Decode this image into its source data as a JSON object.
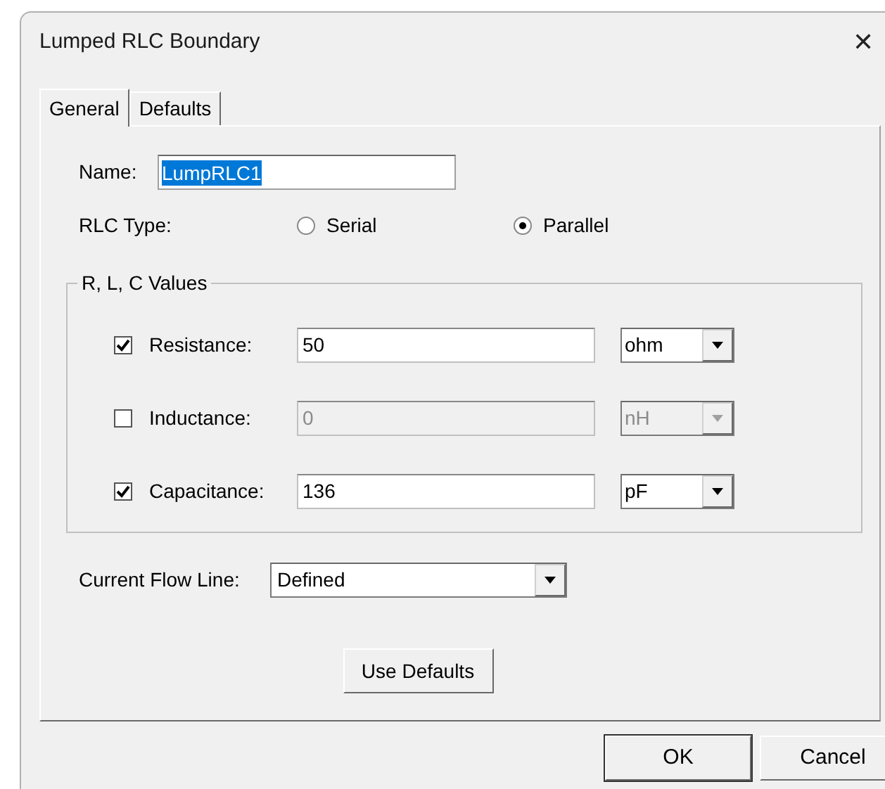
{
  "window": {
    "title": "Lumped RLC Boundary",
    "close": "✕"
  },
  "tabs": [
    {
      "label": "General",
      "selected": true
    },
    {
      "label": "Defaults",
      "selected": false
    }
  ],
  "name": {
    "label": "Name:",
    "value": "LumpRLC1"
  },
  "rlc_type": {
    "label": "RLC Type:",
    "options": [
      {
        "label": "Serial",
        "selected": false
      },
      {
        "label": "Parallel",
        "selected": true
      }
    ]
  },
  "values_group": {
    "title": "R, L, C Values",
    "rows": [
      {
        "label": "Resistance:",
        "checked": true,
        "value": "50",
        "unit": "ohm"
      },
      {
        "label": "Inductance:",
        "checked": false,
        "value": "0",
        "unit": "nH"
      },
      {
        "label": "Capacitance:",
        "checked": true,
        "value": "136",
        "unit": "pF"
      }
    ]
  },
  "current_flow_line": {
    "label": "Current Flow Line:",
    "value": "Defined"
  },
  "use_defaults_button": "Use Defaults",
  "buttons": [
    "OK",
    "Cancel"
  ]
}
